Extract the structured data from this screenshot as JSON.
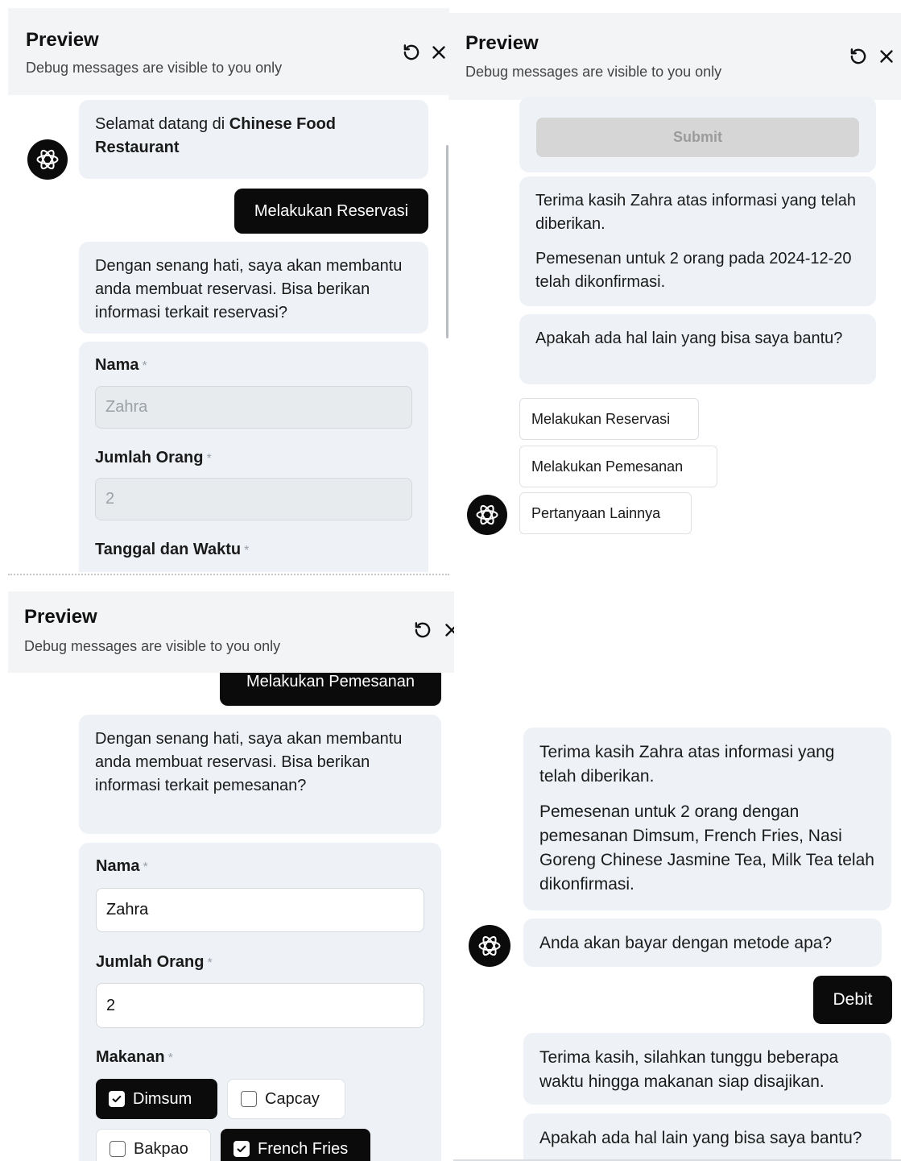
{
  "panels": {
    "reservation": {
      "header": {
        "title": "Preview",
        "subtitle": "Debug messages are visible to you only"
      },
      "welcome": {
        "text": "Selamat datang di ",
        "restaurant": "Chinese Food Restaurant"
      },
      "user_action": "Melakukan Reservasi",
      "bot_reply": "Dengan senang hati, saya akan membantu anda membuat reservasi. Bisa berikan informasi terkait reservasi?",
      "form": {
        "name_label": "Nama",
        "name_value": "Zahra",
        "people_label": "Jumlah Orang",
        "people_value": "2",
        "datetime_label": "Tanggal dan Waktu",
        "required_mark": "*"
      }
    },
    "confirmation": {
      "header": {
        "title": "Preview",
        "subtitle": "Debug messages are visible to you only"
      },
      "submit_label": "Submit",
      "thanks": "Terima kasih Zahra atas informasi yang telah diberikan.",
      "confirm": "Pemesenan untuk 2 orang pada 2024-12-20 telah dikonfirmasi.",
      "follow_up": "Apakah ada hal lain yang bisa saya bantu?",
      "quick_replies": [
        "Melakukan Reservasi",
        "Melakukan Pemesanan",
        "Pertanyaan Lainnya"
      ]
    },
    "order": {
      "header": {
        "title": "Preview",
        "subtitle": "Debug messages are visible to you only"
      },
      "user_action": "Melakukan Pemesanan",
      "bot_reply": "Dengan senang hati, saya akan membantu anda membuat reservasi. Bisa berikan informasi terkait pemesanan?",
      "form": {
        "name_label": "Nama",
        "name_value": "Zahra",
        "people_label": "Jumlah Orang",
        "people_value": "2",
        "food_label": "Makanan",
        "required_mark": "*",
        "food_options": [
          {
            "label": "Dimsum",
            "checked": true
          },
          {
            "label": "Capcay",
            "checked": false
          },
          {
            "label": "Bakpao",
            "checked": false
          },
          {
            "label": "French Fries",
            "checked": true
          }
        ]
      }
    },
    "payment": {
      "thanks": "Terima kasih Zahra atas informasi yang telah diberikan.",
      "confirm": "Pemesenan untuk 2 orang dengan pemesanan Dimsum, French Fries, Nasi Goreng Chinese Jasmine Tea, Milk Tea telah dikonfirmasi.",
      "question": "Anda akan bayar dengan metode apa?",
      "user_choice": "Debit",
      "wait": "Terima kasih, silahkan tunggu beberapa waktu hingga makanan siap disajikan.",
      "follow_up": "Apakah ada hal lain yang bisa saya bantu?"
    }
  },
  "icons": {
    "refresh": "refresh-icon",
    "close": "close-icon",
    "bot": "openai-bot-icon",
    "check": "check-icon"
  },
  "colors": {
    "user_bubble": "#0b0b0b",
    "bot_bubble": "#eef2f7",
    "header_bg": "#f3f4f6",
    "disabled": "#d6d6d6"
  }
}
